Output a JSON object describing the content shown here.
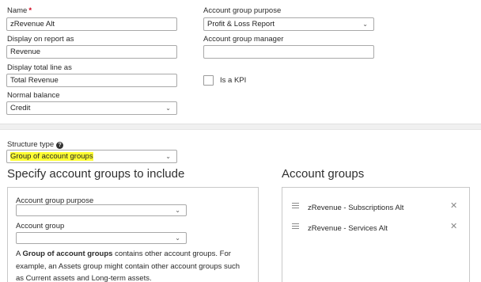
{
  "form": {
    "name_label": "Name",
    "required_mark": "*",
    "name_value": "zRevenue Alt",
    "display_on_report_label": "Display on report as",
    "display_on_report_value": "Revenue",
    "display_total_label": "Display total line as",
    "display_total_value": "Total Revenue",
    "normal_balance_label": "Normal balance",
    "normal_balance_value": "Credit",
    "purpose_label": "Account group purpose",
    "purpose_value": "Profit & Loss Report",
    "manager_label": "Account group manager",
    "manager_value": "",
    "kpi_label": "Is a KPI",
    "structure_type_label": "Structure type",
    "structure_type_value": "Group of account groups"
  },
  "specify": {
    "title": "Specify account groups to include",
    "purpose_label": "Account group purpose",
    "purpose_value": "",
    "group_label": "Account group",
    "group_value": "",
    "desc_prefix": "A ",
    "desc_bold": "Group of account groups",
    "desc_rest": " contains other account groups. For example, an Assets group might contain other account groups such as Current assets and Long-term assets."
  },
  "account_groups": {
    "title": "Account groups",
    "items": [
      {
        "label": "zRevenue - Subscriptions Alt"
      },
      {
        "label": "zRevenue - Services Alt"
      }
    ]
  },
  "icons": {
    "chevron": "chevron-down-icon",
    "help": "question-circle-icon",
    "drag": "drag-handle-icon",
    "remove": "close-icon"
  }
}
